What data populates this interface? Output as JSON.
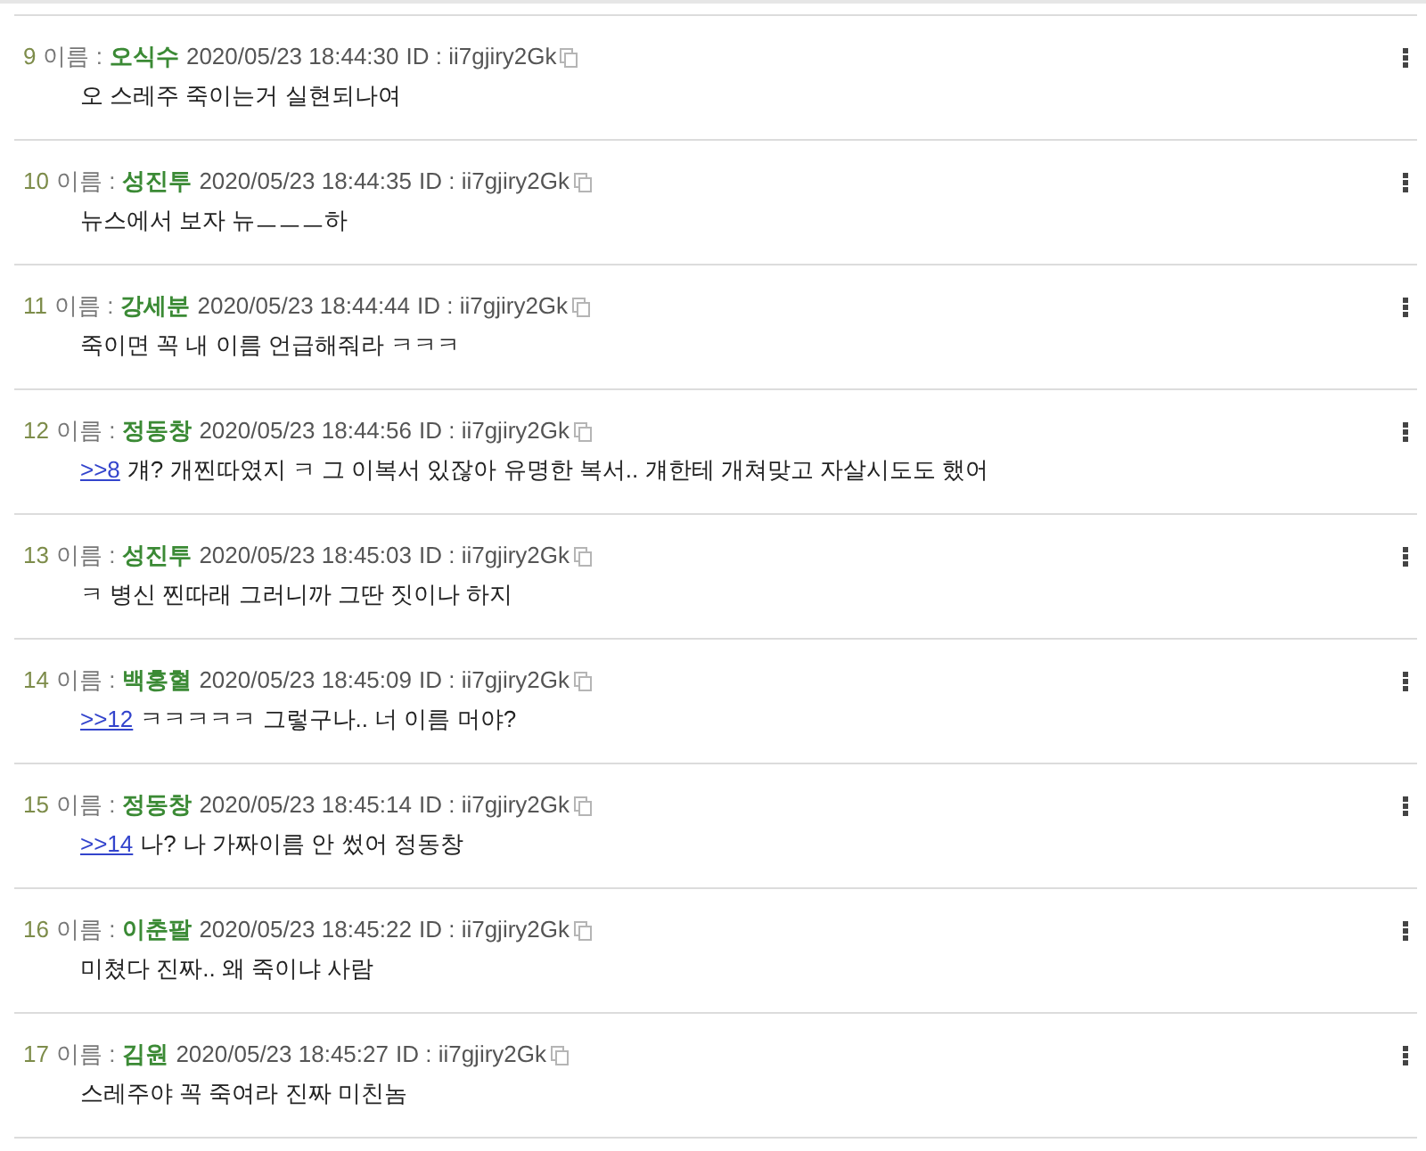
{
  "posts": [
    {
      "number": "9",
      "name_label": "이름 :",
      "name": "오식수",
      "timestamp": "2020/05/23 18:44:30",
      "id": "ID : ii7gjiry2Gk",
      "text": "오 스레주 죽이는거 실현되나여"
    },
    {
      "number": "10",
      "name_label": "이름 :",
      "name": "성진투",
      "timestamp": "2020/05/23 18:44:35",
      "id": "ID : ii7gjiry2Gk",
      "text": "뉴스에서 보자 뉴ㅡㅡㅡ하"
    },
    {
      "number": "11",
      "name_label": "이름 :",
      "name": "강세분",
      "timestamp": "2020/05/23 18:44:44",
      "id": "ID : ii7gjiry2Gk",
      "text": "죽이면 꼭 내 이름 언급해줘라 ㅋㅋㅋ"
    },
    {
      "number": "12",
      "name_label": "이름 :",
      "name": "정동창",
      "timestamp": "2020/05/23 18:44:56",
      "id": "ID : ii7gjiry2Gk",
      "reply_link": ">>8",
      "text": "걔? 개찐따였지 ㅋ 그 이복서 있잖아 유명한 복서.. 걔한테 개쳐맞고 자살시도도 했어"
    },
    {
      "number": "13",
      "name_label": "이름 :",
      "name": "성진투",
      "timestamp": "2020/05/23 18:45:03",
      "id": "ID : ii7gjiry2Gk",
      "text": "ㅋ 병신 찐따래 그러니까 그딴 짓이나 하지"
    },
    {
      "number": "14",
      "name_label": "이름 :",
      "name": "백홍혈",
      "timestamp": "2020/05/23 18:45:09",
      "id": "ID : ii7gjiry2Gk",
      "reply_link": ">>12",
      "text": "ㅋㅋㅋㅋㅋ 그렇구나.. 너 이름 머야?"
    },
    {
      "number": "15",
      "name_label": "이름 :",
      "name": "정동창",
      "timestamp": "2020/05/23 18:45:14",
      "id": "ID : ii7gjiry2Gk",
      "reply_link": ">>14",
      "text": "나? 나 가짜이름 안 썼어 정동창"
    },
    {
      "number": "16",
      "name_label": "이름 :",
      "name": "이춘팔",
      "timestamp": "2020/05/23 18:45:22",
      "id": "ID : ii7gjiry2Gk",
      "text": "미쳤다 진짜.. 왜 죽이냐 사람"
    },
    {
      "number": "17",
      "name_label": "이름 :",
      "name": "김원",
      "timestamp": "2020/05/23 18:45:27",
      "id": "ID : ii7gjiry2Gk",
      "text": "스레주야 꼭 죽여라 진짜 미친놈"
    }
  ]
}
